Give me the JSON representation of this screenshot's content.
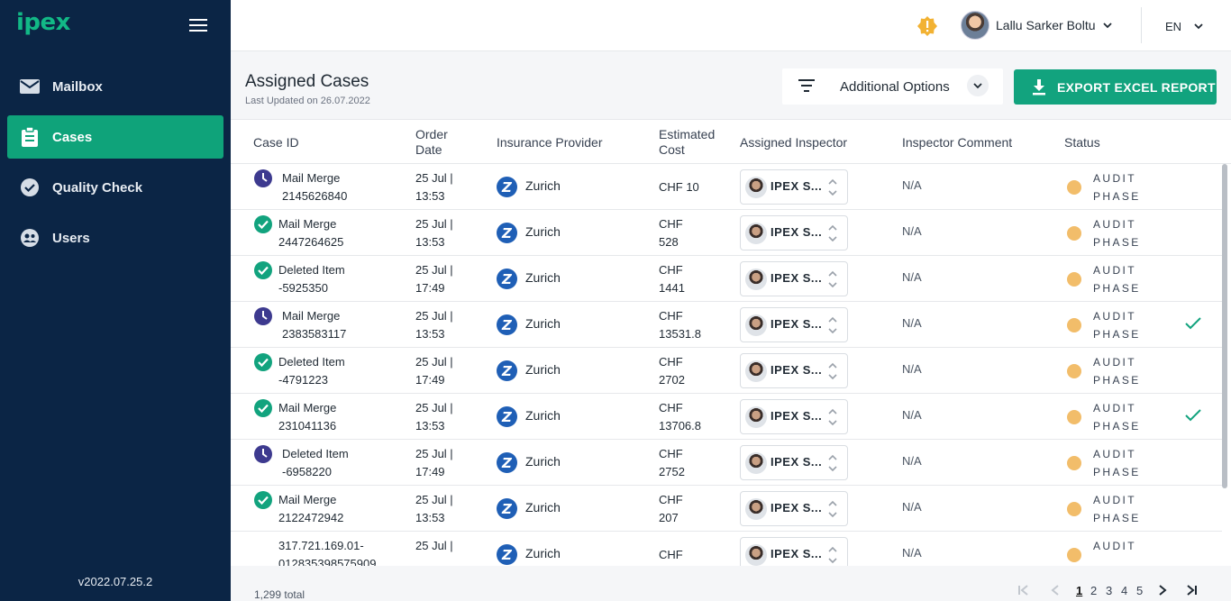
{
  "sidebar": {
    "logo": "ipex",
    "items": [
      {
        "label": "Mailbox",
        "icon": "mail-icon"
      },
      {
        "label": "Cases",
        "icon": "clipboard-icon",
        "active": true
      },
      {
        "label": "Quality Check",
        "icon": "check-circle-icon"
      },
      {
        "label": "Users",
        "icon": "users-icon"
      }
    ],
    "version": "v2022.07.25.2"
  },
  "topbar": {
    "user_name": "Lallu Sarker Boltu",
    "language": "EN",
    "alert_color": "#f2b233"
  },
  "header": {
    "title": "Assigned Cases",
    "last_updated": "Last Updated on 26.07.2022",
    "options_label": "Additional Options",
    "export_label": "EXPORT EXCEL REPORT"
  },
  "table": {
    "columns": {
      "case_id": "Case ID",
      "order_date_1": "Order",
      "order_date_2": "Date",
      "provider": "Insurance Provider",
      "cost_1": "Estimated",
      "cost_2": "Cost",
      "inspector": "Assigned Inspector",
      "comment": "Inspector Comment",
      "status": "Status"
    },
    "rows": [
      {
        "icon": "clock",
        "case1": "Mail Merge",
        "case2": "2145626840",
        "date1": "25 Jul |",
        "date2": "13:53",
        "provider": "Zurich",
        "cost1": "CHF 10",
        "cost2": "",
        "inspector": "IPEX S...",
        "comment": "N/A",
        "status1": "AUDIT",
        "status2": "PHASE",
        "checked": false
      },
      {
        "icon": "check",
        "case1": "Mail Merge",
        "case2": "2447264625",
        "date1": "25 Jul |",
        "date2": "13:53",
        "provider": "Zurich",
        "cost1": "CHF",
        "cost2": "528",
        "inspector": "IPEX S...",
        "comment": "N/A",
        "status1": "AUDIT",
        "status2": "PHASE",
        "checked": false
      },
      {
        "icon": "check",
        "case1": "Deleted Item",
        "case2": "-5925350",
        "date1": "25 Jul |",
        "date2": "17:49",
        "provider": "Zurich",
        "cost1": "CHF",
        "cost2": "1441",
        "inspector": "IPEX S...",
        "comment": "N/A",
        "status1": "AUDIT",
        "status2": "PHASE",
        "checked": false
      },
      {
        "icon": "clock",
        "case1": "Mail Merge",
        "case2": "2383583117",
        "date1": "25 Jul |",
        "date2": "13:53",
        "provider": "Zurich",
        "cost1": "CHF",
        "cost2": "13531.8",
        "inspector": "IPEX S...",
        "comment": "N/A",
        "status1": "AUDIT",
        "status2": "PHASE",
        "checked": true
      },
      {
        "icon": "check",
        "case1": "Deleted Item",
        "case2": "-4791223",
        "date1": "25 Jul |",
        "date2": "17:49",
        "provider": "Zurich",
        "cost1": "CHF",
        "cost2": "2702",
        "inspector": "IPEX S...",
        "comment": "N/A",
        "status1": "AUDIT",
        "status2": "PHASE",
        "checked": false
      },
      {
        "icon": "check",
        "case1": "Mail Merge",
        "case2": "231041136",
        "date1": "25 Jul |",
        "date2": "13:53",
        "provider": "Zurich",
        "cost1": "CHF",
        "cost2": "13706.8",
        "inspector": "IPEX S...",
        "comment": "N/A",
        "status1": "AUDIT",
        "status2": "PHASE",
        "checked": true
      },
      {
        "icon": "clock",
        "case1": "Deleted Item",
        "case2": "-6958220",
        "date1": "25 Jul |",
        "date2": "17:49",
        "provider": "Zurich",
        "cost1": "CHF",
        "cost2": "2752",
        "inspector": "IPEX S...",
        "comment": "N/A",
        "status1": "AUDIT",
        "status2": "PHASE",
        "checked": false
      },
      {
        "icon": "check",
        "case1": "Mail Merge",
        "case2": "2122472942",
        "date1": "25 Jul |",
        "date2": "13:53",
        "provider": "Zurich",
        "cost1": "CHF",
        "cost2": "207",
        "inspector": "IPEX S...",
        "comment": "N/A",
        "status1": "AUDIT",
        "status2": "PHASE",
        "checked": false
      },
      {
        "icon": "none",
        "case1": "317.721.169.01-",
        "case2": "012835398575909",
        "date1": "25 Jul |",
        "date2": "",
        "provider": "Zurich",
        "cost1": "CHF",
        "cost2": "",
        "inspector": "IPEX S...",
        "comment": "N/A",
        "status1": "AUDIT",
        "status2": "",
        "checked": false
      }
    ]
  },
  "footer": {
    "total": "1,299 total",
    "pages": [
      "1",
      "2",
      "3",
      "4",
      "5"
    ],
    "current_page": "1"
  },
  "colors": {
    "sidebar_bg": "#0b2545",
    "accent": "#12a37e",
    "clock_icon": "#3d3a8f",
    "check_icon": "#12a37e",
    "status_dot": "#f2bd6a"
  }
}
